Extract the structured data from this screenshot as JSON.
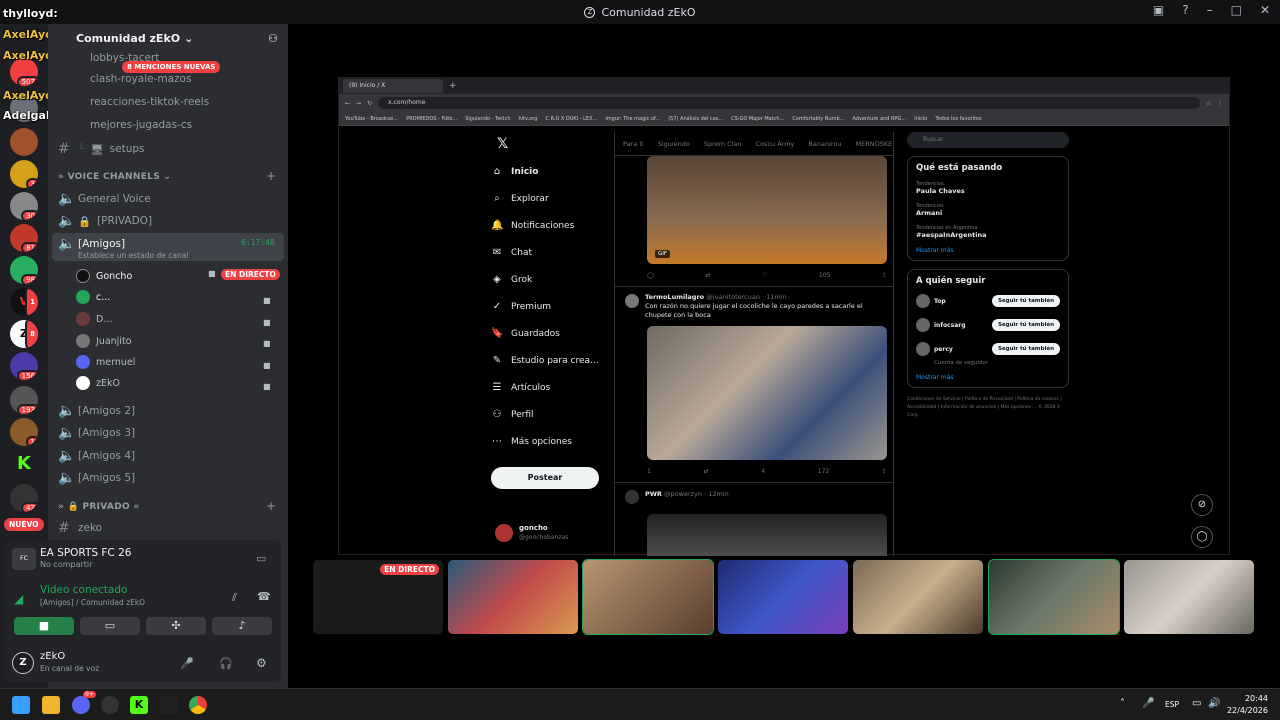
{
  "window": {
    "title": "Comunidad zEkO",
    "icons": [
      "inbox-icon",
      "help-icon",
      "minimize-icon",
      "maximize-icon",
      "close-icon"
    ]
  },
  "overlay": {
    "names": [
      "thylloyd:",
      "AxelAyon:",
      "AxelAyon:",
      "AxelAyon:",
      "AdelgaFRUTA:"
    ],
    "badges": [
      "507",
      "37"
    ]
  },
  "server": {
    "name": "Comunidad zEkO",
    "mentions_banner": "8 MENCIONES NUEVAS",
    "new_badge": "NUEVO",
    "badges": [
      "3",
      "30",
      "81",
      "98",
      "1",
      "8",
      "156",
      "193",
      "1",
      "42"
    ]
  },
  "channels": {
    "text": [
      "lobbys-tacert",
      "clash-royale-mazos",
      "reacciones-tiktok-reels",
      "mejores-jugadas-cs",
      "setups"
    ],
    "voice_category": "VOICE CHANNELS",
    "voice": [
      "General Voice",
      "[PRIVADO]",
      "[Amigos]"
    ],
    "active_timer": "6:17:48",
    "status_hint": "Establece un estado de canal",
    "members": [
      "Goncho",
      "c...",
      "D...",
      "Juanjito",
      "mernuel",
      "zEkO"
    ],
    "live_label": "EN DIRECTO",
    "more_voice": [
      "[Amigos 2]",
      "[Amigos 3]",
      "[Amigos 4]",
      "[Amigos 5]"
    ],
    "private_category": "PRIVADO",
    "private_channels": [
      "zeko"
    ]
  },
  "activity": {
    "game": "EA SPORTS FC 26",
    "sub": "No compartir",
    "voice_status": "Video conectado",
    "voice_location": "[Amigos] / Comunidad zEkO"
  },
  "user": {
    "name": "zEkO",
    "status": "En canal de voz"
  },
  "browser": {
    "tab": "(9) Inicio / X",
    "url": "x.com/home",
    "bookmarks": [
      "YouTube - Broadcas...",
      "PROMIEDOS - Fútb...",
      "Siguiendo - Twitch",
      "hltv.org",
      "C.R.O X DUKI - LEX...",
      "Imgur: The magic of...",
      "(57) Análisis del cas...",
      "CS:GO Major Match...",
      "Comfortably Numb...",
      "Adventure and RPG...",
      "Inicio",
      "Todos los favoritos"
    ]
  },
  "x": {
    "nav": [
      "Inicio",
      "Explorar",
      "Notificaciones",
      "Chat",
      "Grok",
      "Premium",
      "Guardados",
      "Estudio para crea...",
      "Artículos",
      "Perfil",
      "Más opciones"
    ],
    "post_button": "Postear",
    "account": {
      "name": "goncho",
      "handle": "@gonchobanzas"
    },
    "feed_tabs": [
      "Para ti",
      "Siguiendo",
      "Sprem Clan",
      "Coscu Army",
      "Bananirou",
      "MERNOSKE"
    ],
    "gif_label": "GIF",
    "tweets": [
      {
        "name": "TermoLumilagro",
        "handle": "@juanitotercuan · 11min",
        "text": "Con razón no quiere jugar el cocoliche le cayo paredes a sacarle  el chupete con la boca",
        "stats": [
          "1",
          "",
          "4",
          "172"
        ]
      },
      {
        "name": "PWR",
        "handle": "@powerzyn · 12min",
        "text": "",
        "stats": []
      }
    ],
    "first_stats": [
      "",
      "",
      "",
      "105"
    ],
    "search_placeholder": "Buscar",
    "trends_title": "Qué está pasando",
    "trends": [
      {
        "sub": "Tendencias",
        "name": "Paula Chaves"
      },
      {
        "sub": "Tendencias",
        "name": "Armani"
      },
      {
        "sub": "Tendencias en Argentina",
        "name": "#aespaInArgentina"
      }
    ],
    "show_more": "Mostrar más",
    "follow_title": "A quién seguir",
    "follow": [
      {
        "name": "Top",
        "handle": "@Top..."
      },
      {
        "name": "infocsarg",
        "handle": "@info..."
      },
      {
        "name": "percy",
        "handle": "@star..."
      }
    ],
    "follow_button": "Seguir tú también",
    "follow_note": "Cuenta de seguidor",
    "footer": "Condiciones de Servicio | Política de Privacidad | Política de cookies | Accesibilidad | Información de anuncios | Más opciones ... © 2026 X Corp."
  },
  "streams": {
    "live_label": "EN DIRECTO",
    "count": 7
  },
  "taskbar": {
    "lang": "ESP",
    "time": "20:44",
    "date": "22/4/2026",
    "discord_badge": "9+"
  }
}
